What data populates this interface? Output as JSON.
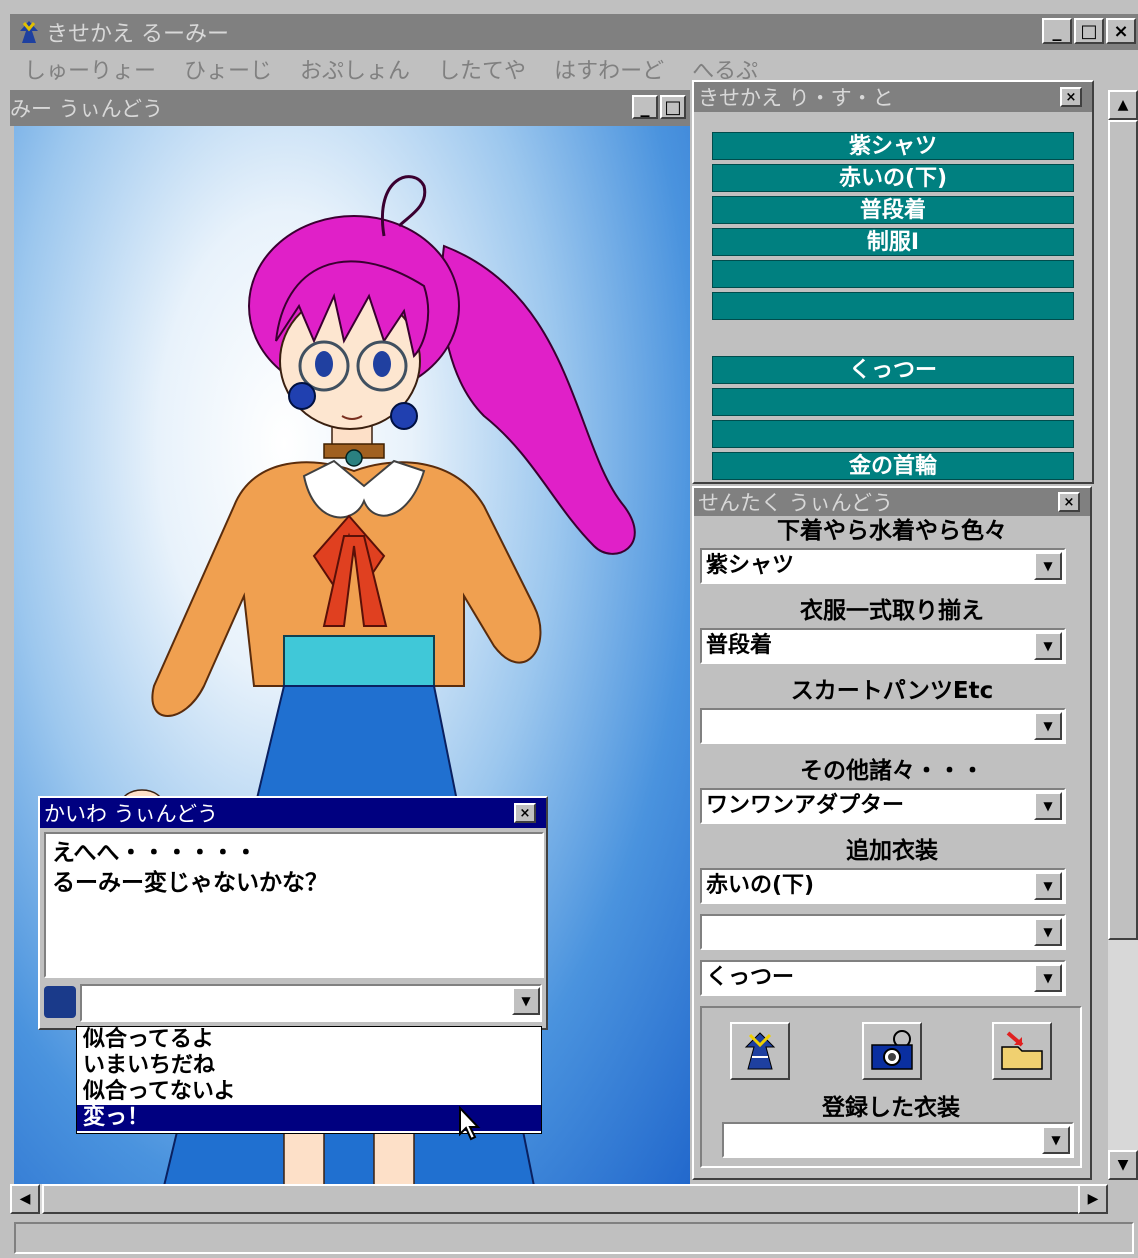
{
  "main_window": {
    "title": "きせかえ るーみー"
  },
  "menu": [
    "しゅーりょー",
    "ひょーじ",
    "おぷしょん",
    "したてや",
    "はすわーど",
    "へるぷ"
  ],
  "child_window": {
    "title": "みー うぃんどう"
  },
  "list_panel": {
    "title": "きせかえ り・す・と",
    "slots": [
      {
        "label": "紫シャツ"
      },
      {
        "label": "赤いの(下)"
      },
      {
        "label": "普段着"
      },
      {
        "label": "制服Ⅰ"
      },
      {
        "label": ""
      },
      {
        "label": ""
      },
      {
        "label": "くっつー",
        "gap_before": true
      },
      {
        "label": ""
      },
      {
        "label": ""
      },
      {
        "label": "金の首輪"
      }
    ]
  },
  "select_panel": {
    "title": "せんたく うぃんどう",
    "sections": [
      {
        "label": "下着やら水着やら色々",
        "value": "紫シャツ"
      },
      {
        "label": "衣服一式取り揃え",
        "value": "普段着"
      },
      {
        "label": "スカートパンツEtc",
        "value": ""
      },
      {
        "label": "その他諸々・・・",
        "value": "ワンワンアダプター"
      },
      {
        "label": "追加衣装",
        "value": "赤いの(下)"
      }
    ],
    "extra_combos": [
      "",
      "くっつー"
    ],
    "registered_label": "登録した衣装",
    "registered_value": ""
  },
  "dialog": {
    "title": "かいわ うぃんどう",
    "lines": [
      "えへへ・・・・・・",
      "るーみー変じゃないかな？"
    ],
    "reply_options": [
      "似合ってるよ",
      "いまいちだね",
      "似合ってないよ",
      "変っ！"
    ],
    "selected_index": 3
  },
  "colors": {
    "slot": "#008080",
    "active_title": "#000080",
    "inactive_title": "#808080",
    "face": "#c0c0c0"
  },
  "icons": [
    "app-icon",
    "minimize-icon",
    "maximize-icon",
    "close-icon",
    "dress-icon",
    "camera-icon",
    "folder-arrow-icon",
    "arrow-cursor-icon"
  ]
}
